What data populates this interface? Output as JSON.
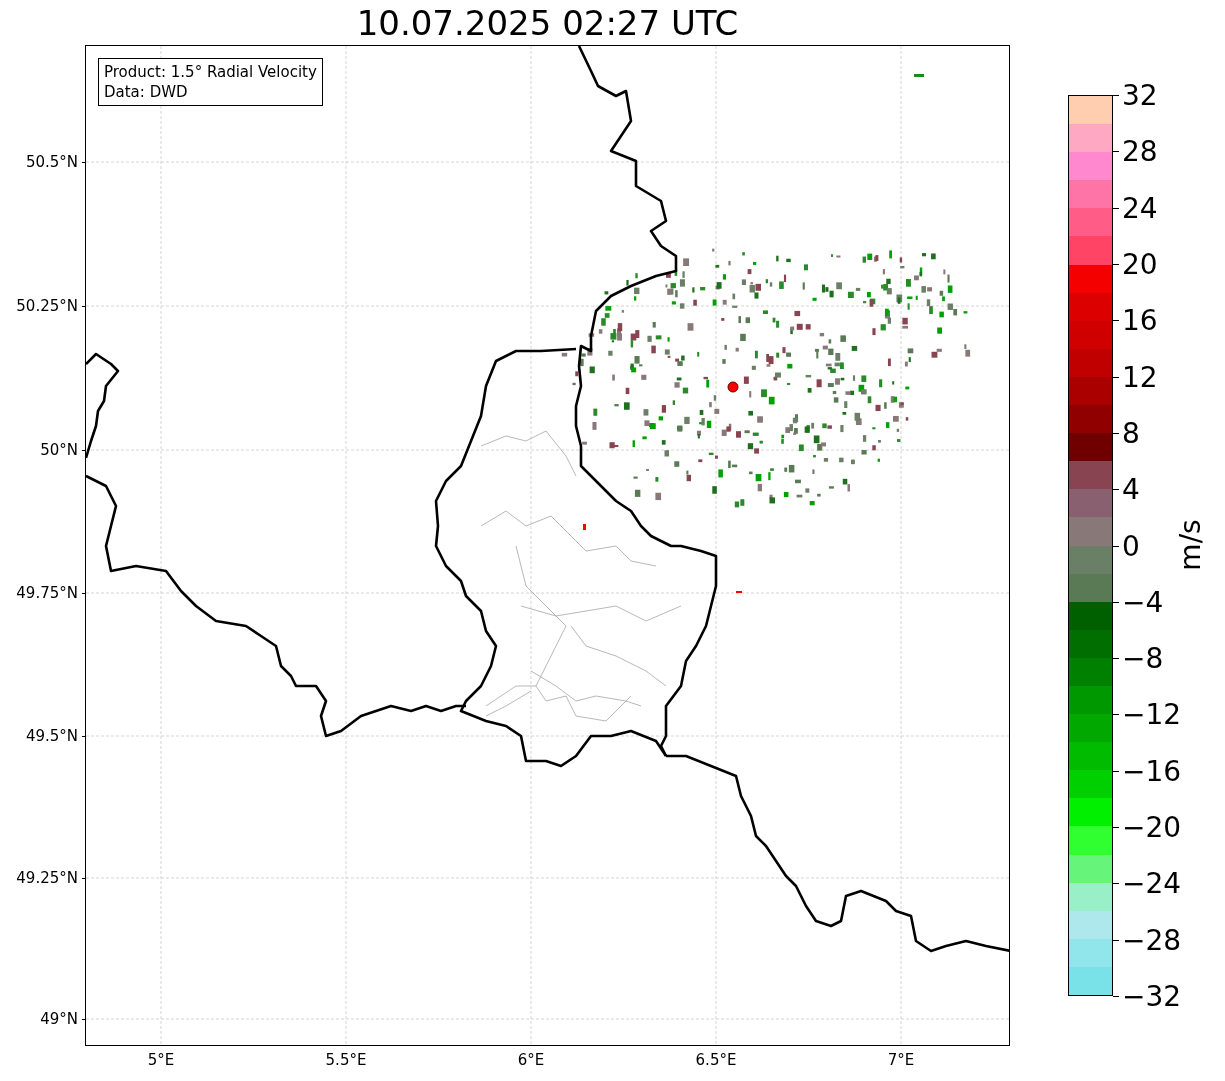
{
  "title": "10.07.2025 02:27 UTC",
  "info_box": {
    "lines": [
      "Product: 1.5° Radial Velocity",
      "Data: DWD"
    ]
  },
  "map": {
    "lat_labels": [
      "50.5°N",
      "50.25°N",
      "50°N",
      "49.75°N",
      "49.5°N",
      "49.25°N",
      "49°N"
    ],
    "lon_labels": [
      "5°E",
      "5.5°E",
      "6°E",
      "6.5°E",
      "7°E"
    ]
  },
  "colorbar": {
    "unit": "m/s",
    "ticks": [
      "32",
      "28",
      "24",
      "20",
      "16",
      "12",
      "8",
      "4",
      "0",
      "−4",
      "−8",
      "−12",
      "−16",
      "−20",
      "−24",
      "−28",
      "−32"
    ],
    "segments": [
      {
        "color": "#ffcdb0"
      },
      {
        "color": "#ffa8c4"
      },
      {
        "color": "#ff88cf"
      },
      {
        "color": "#ff74a6"
      },
      {
        "color": "#ff5c88"
      },
      {
        "color": "#ff4466"
      },
      {
        "color": "#f50000"
      },
      {
        "color": "#dd0000"
      },
      {
        "color": "#d00000"
      },
      {
        "color": "#c00000"
      },
      {
        "color": "#aa0000"
      },
      {
        "color": "#900000"
      },
      {
        "color": "#700000"
      },
      {
        "color": "#884450"
      },
      {
        "color": "#886070"
      },
      {
        "color": "#887878"
      },
      {
        "color": "#6a8066"
      },
      {
        "color": "#5a7a55"
      },
      {
        "color": "#006000"
      },
      {
        "color": "#006e00"
      },
      {
        "color": "#008000"
      },
      {
        "color": "#009800"
      },
      {
        "color": "#00a800"
      },
      {
        "color": "#00bb00"
      },
      {
        "color": "#00d000"
      },
      {
        "color": "#00f000"
      },
      {
        "color": "#30ff30"
      },
      {
        "color": "#66f57a"
      },
      {
        "color": "#99f0c8"
      },
      {
        "color": "#aee8ec"
      },
      {
        "color": "#90e6ea"
      },
      {
        "color": "#78e2e8"
      }
    ]
  }
}
